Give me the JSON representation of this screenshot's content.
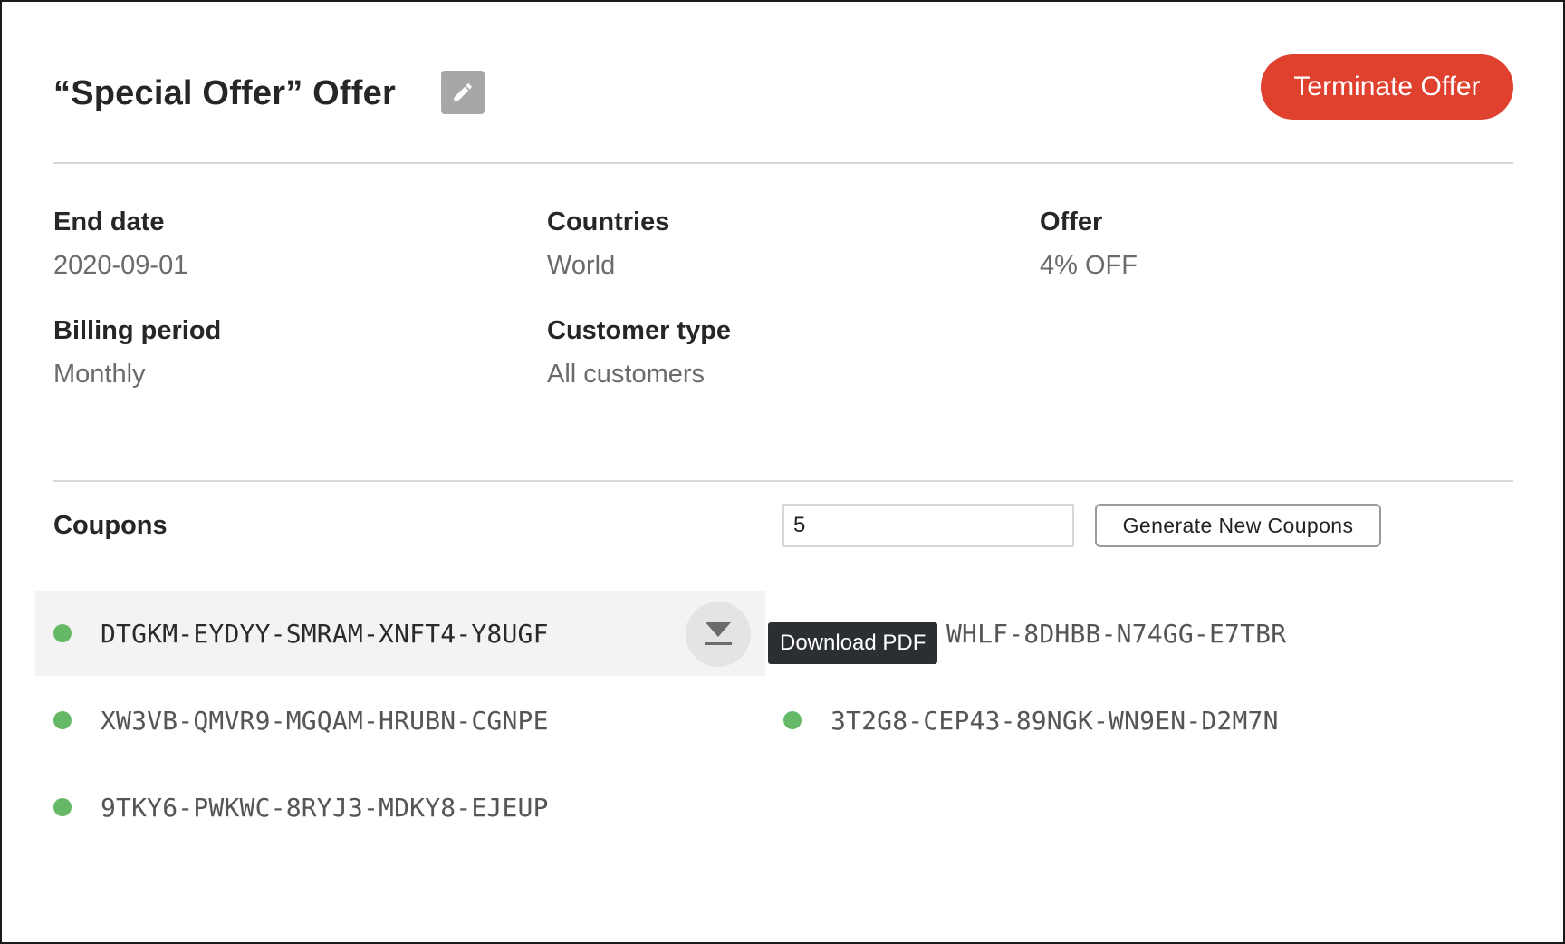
{
  "header": {
    "title": "“Special Offer” Offer",
    "edit_icon": "pencil-icon",
    "terminate_label": "Terminate Offer"
  },
  "details": {
    "end_date": {
      "label": "End date",
      "value": "2020-09-01"
    },
    "countries": {
      "label": "Countries",
      "value": "World"
    },
    "offer": {
      "label": "Offer",
      "value": "4% OFF"
    },
    "billing_period": {
      "label": "Billing period",
      "value": "Monthly"
    },
    "customer_type": {
      "label": "Customer type",
      "value": "All customers"
    }
  },
  "coupons": {
    "title": "Coupons",
    "count_value": "5",
    "generate_label": "Generate New Coupons",
    "items": [
      {
        "code": "DTGKM-EYDYY-SMRAM-XNFT4-Y8UGF",
        "status": "active"
      },
      {
        "code": "WHLF-8DHBB-N74GG-E7TBR",
        "status": "active"
      },
      {
        "code": "XW3VB-QMVR9-MGQAM-HRUBN-CGNPE",
        "status": "active"
      },
      {
        "code": "3T2G8-CEP43-89NGK-WN9EN-D2M7N",
        "status": "active"
      },
      {
        "code": "9TKY6-PWKWC-8RYJ3-MDKY8-EJEUP",
        "status": "active"
      }
    ],
    "download_icon": "download-icon",
    "tooltip": "Download PDF"
  },
  "colors": {
    "accent": "#e0412f",
    "status_active": "#64b866",
    "edit_button": "#a7a7a7",
    "tooltip_bg": "#2b2e33"
  }
}
